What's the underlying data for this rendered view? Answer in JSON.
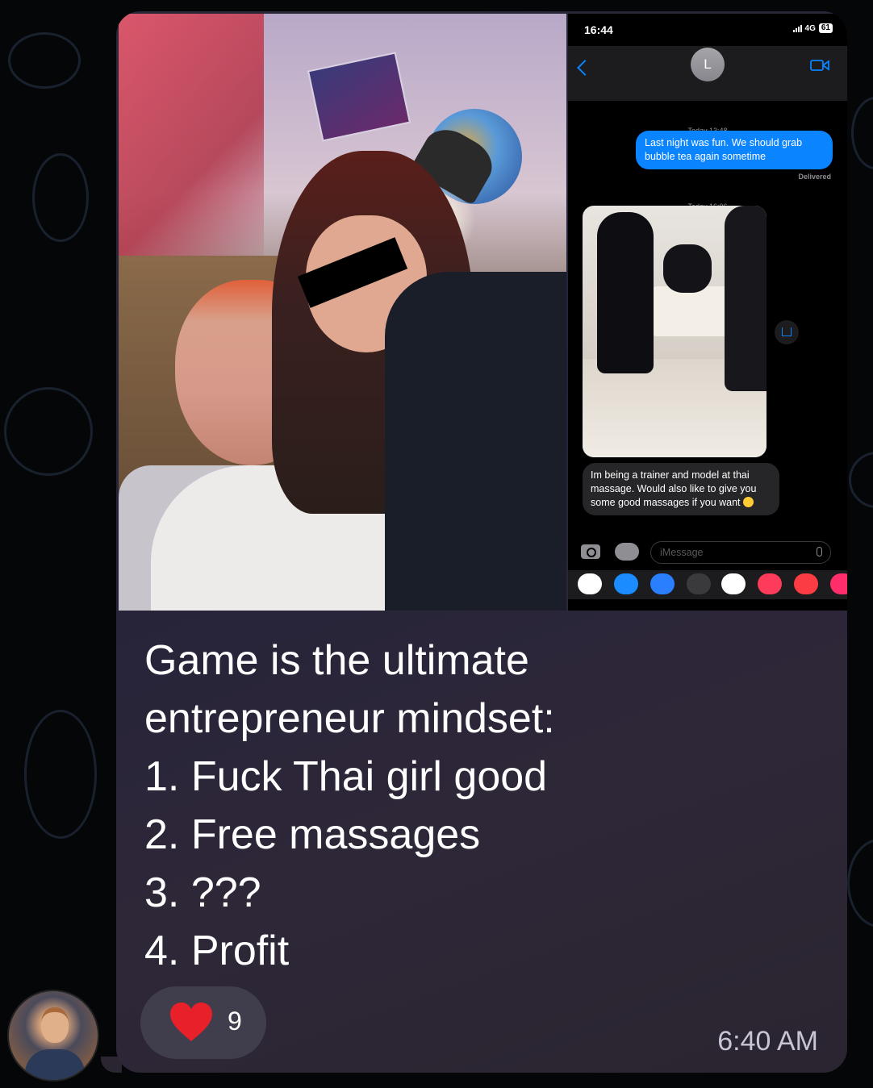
{
  "phone": {
    "status_time": "16:44",
    "network": "4G",
    "battery": "61",
    "contact_initial": "L",
    "timestamp_1": "Today 13:48",
    "sent_message": "Last night was fun. We should grab bubble tea again sometime",
    "delivered_label": "Delivered",
    "timestamp_2": "Today 16:06",
    "received_message": "Im being a trainer and model at thai massage. Would also like to give you some good massages if you want",
    "compose_placeholder": "iMessage"
  },
  "caption": {
    "lines": [
      "Game is the ultimate",
      "entrepreneur mindset:",
      "1. Fuck Thai girl good",
      "2. Free massages",
      "3. ???",
      "4. Profit"
    ]
  },
  "reaction": {
    "icon": "heart-icon",
    "count": "9"
  },
  "message_time": "6:40 AM",
  "colors": {
    "imessage_blue": "#0a84ff",
    "bubble_bg": "#2a2838",
    "heart_red": "#e8202a"
  }
}
